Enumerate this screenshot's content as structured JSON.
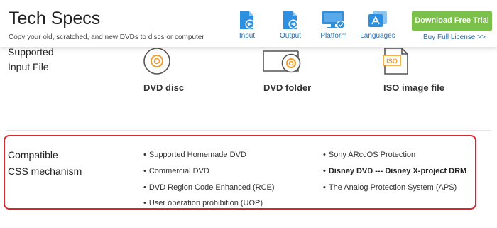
{
  "header": {
    "title": "Tech Specs",
    "subtitle": "Copy your old, scratched, and new DVDs to discs or computer",
    "nav": [
      {
        "label": "Input",
        "icon": "input-file-icon"
      },
      {
        "label": "Output",
        "icon": "output-file-icon"
      },
      {
        "label": "Platform",
        "icon": "platform-monitor-icon"
      },
      {
        "label": "Languages",
        "icon": "languages-icon"
      }
    ],
    "cta_label": "Download Free Trial",
    "license_link": "Buy Full License >>",
    "accent_color": "#2c8fe0",
    "cta_color": "#7bc04a"
  },
  "supported_input": {
    "label_line1": "Supported",
    "label_line2": "Input File",
    "items": [
      {
        "caption": "DVD disc",
        "icon": "dvd-disc-icon"
      },
      {
        "caption": "DVD folder",
        "icon": "dvd-folder-icon"
      },
      {
        "caption": "ISO image file",
        "icon": "iso-file-icon"
      }
    ]
  },
  "css_mechanism": {
    "label_line1": "Compatible",
    "label_line2": "CSS mechanism",
    "highlight_color": "#d6262e",
    "col1": [
      "Supported Homemade DVD",
      "Commercial DVD",
      "DVD Region Code Enhanced (RCE)",
      "User operation prohibition (UOP)"
    ],
    "col2": [
      "Sony ARccOS Protection",
      "Disney DVD --- Disney X-project DRM",
      "The Analog Protection System (APS)"
    ]
  }
}
